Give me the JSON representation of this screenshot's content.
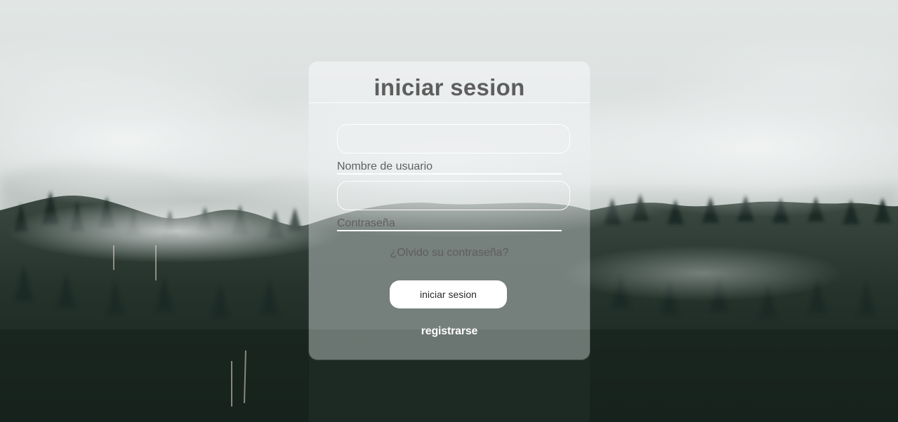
{
  "login_card": {
    "title": "iniciar sesion",
    "username_label": "Nombre de usuario",
    "password_label": "Contraseña",
    "username_value": "",
    "password_value": "",
    "forgot_password_text": "¿Olvido su contraseña?",
    "login_button_label": "iniciar sesion",
    "register_link_text": "registrarse"
  },
  "background": {
    "description_icon": "misty-forest-background",
    "colors": {
      "sky_fog": "#dfe3e3",
      "forest_dark": "#1d2a24",
      "forest_mid": "#2f3d36"
    }
  }
}
